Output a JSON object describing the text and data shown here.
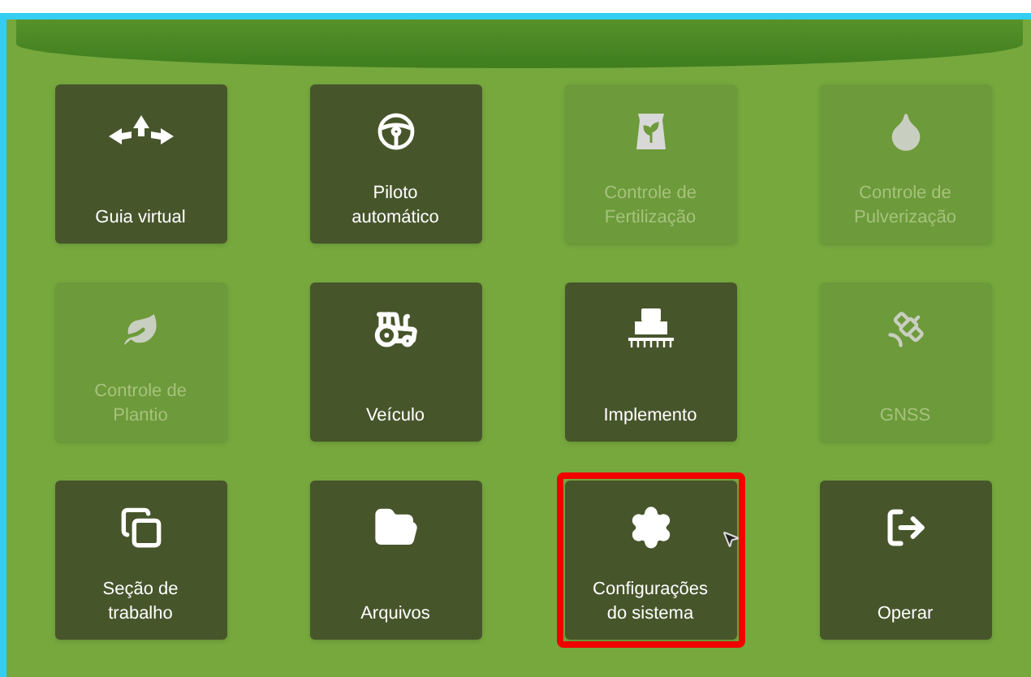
{
  "tiles": [
    {
      "lines": [
        "Guia virtual"
      ],
      "disabled": false,
      "selected": false
    },
    {
      "lines": [
        "Piloto",
        "automático"
      ],
      "disabled": false,
      "selected": false
    },
    {
      "lines": [
        "Controle de",
        "Fertilização"
      ],
      "disabled": true,
      "selected": false
    },
    {
      "lines": [
        "Controle de",
        "Pulverização"
      ],
      "disabled": true,
      "selected": false
    },
    {
      "lines": [
        "Controle de",
        "Plantio"
      ],
      "disabled": true,
      "selected": false
    },
    {
      "lines": [
        "Veículo"
      ],
      "disabled": false,
      "selected": false
    },
    {
      "lines": [
        "Implemento"
      ],
      "disabled": false,
      "selected": false
    },
    {
      "lines": [
        "GNSS"
      ],
      "disabled": true,
      "selected": false
    },
    {
      "lines": [
        "Seção de",
        "trabalho"
      ],
      "disabled": false,
      "selected": false
    },
    {
      "lines": [
        "Arquivos"
      ],
      "disabled": false,
      "selected": false
    },
    {
      "lines": [
        "Configurações",
        "do sistema"
      ],
      "disabled": false,
      "selected": true
    },
    {
      "lines": [
        "Operar"
      ],
      "disabled": false,
      "selected": false
    }
  ]
}
